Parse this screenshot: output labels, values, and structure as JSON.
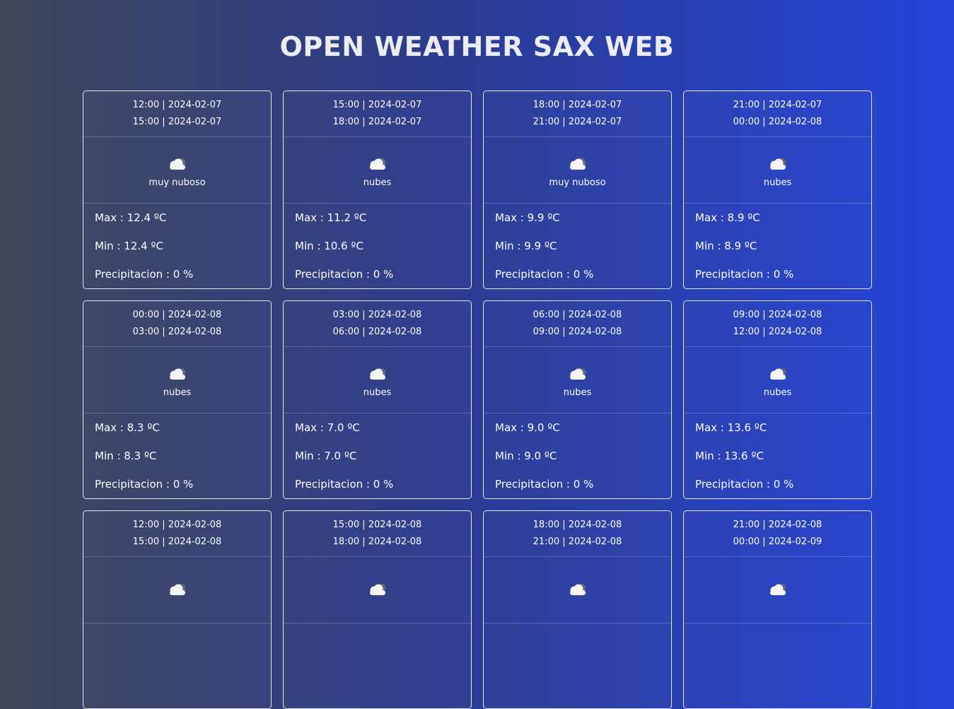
{
  "title": "OPEN WEATHER SAX WEB",
  "cards": [
    {
      "from": "12:00 | 2024-02-07",
      "to": "15:00 | 2024-02-07",
      "icon": "cloud-icon",
      "desc": "muy nuboso",
      "max": "Max : 12.4 ºC",
      "min": "Min : 12.4 ºC",
      "precip": "Precipitacion : 0 %"
    },
    {
      "from": "15:00 | 2024-02-07",
      "to": "18:00 | 2024-02-07",
      "icon": "cloud-icon",
      "desc": "nubes",
      "max": "Max : 11.2 ºC",
      "min": "Min : 10.6 ºC",
      "precip": "Precipitacion : 0 %"
    },
    {
      "from": "18:00 | 2024-02-07",
      "to": "21:00 | 2024-02-07",
      "icon": "cloud-icon",
      "desc": "muy nuboso",
      "max": "Max : 9.9 ºC",
      "min": "Min : 9.9 ºC",
      "precip": "Precipitacion : 0 %"
    },
    {
      "from": "21:00 | 2024-02-07",
      "to": "00:00 | 2024-02-08",
      "icon": "cloud-icon",
      "desc": "nubes",
      "max": "Max : 8.9 ºC",
      "min": "Min : 8.9 ºC",
      "precip": "Precipitacion : 0 %"
    },
    {
      "from": "00:00 | 2024-02-08",
      "to": "03:00 | 2024-02-08",
      "icon": "cloud-icon",
      "desc": "nubes",
      "max": "Max : 8.3 ºC",
      "min": "Min : 8.3 ºC",
      "precip": "Precipitacion : 0 %"
    },
    {
      "from": "03:00 | 2024-02-08",
      "to": "06:00 | 2024-02-08",
      "icon": "cloud-icon",
      "desc": "nubes",
      "max": "Max : 7.0 ºC",
      "min": "Min : 7.0 ºC",
      "precip": "Precipitacion : 0 %"
    },
    {
      "from": "06:00 | 2024-02-08",
      "to": "09:00 | 2024-02-08",
      "icon": "cloud-icon",
      "desc": "nubes",
      "max": "Max : 9.0 ºC",
      "min": "Min : 9.0 ºC",
      "precip": "Precipitacion : 0 %"
    },
    {
      "from": "09:00 | 2024-02-08",
      "to": "12:00 | 2024-02-08",
      "icon": "cloud-icon",
      "desc": "nubes",
      "max": "Max : 13.6 ºC",
      "min": "Min : 13.6 ºC",
      "precip": "Precipitacion : 0 %"
    },
    {
      "from": "12:00 | 2024-02-08",
      "to": "15:00 | 2024-02-08",
      "icon": "cloud-icon",
      "desc": "",
      "max": "",
      "min": "",
      "precip": ""
    },
    {
      "from": "15:00 | 2024-02-08",
      "to": "18:00 | 2024-02-08",
      "icon": "cloud-icon",
      "desc": "",
      "max": "",
      "min": "",
      "precip": ""
    },
    {
      "from": "18:00 | 2024-02-08",
      "to": "21:00 | 2024-02-08",
      "icon": "cloud-icon",
      "desc": "",
      "max": "",
      "min": "",
      "precip": ""
    },
    {
      "from": "21:00 | 2024-02-08",
      "to": "00:00 | 2024-02-09",
      "icon": "cloud-icon",
      "desc": "",
      "max": "",
      "min": "",
      "precip": ""
    }
  ]
}
